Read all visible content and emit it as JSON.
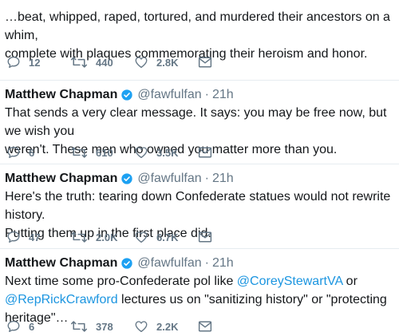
{
  "colors": {
    "text": "#14171a",
    "muted": "#657786",
    "link": "#1b95e0",
    "verified": "#1da1f2"
  },
  "tweets": [
    {
      "body": "…beat, whipped, raped, tortured, and murdered their ancestors on a whim,\ncomplete with plaques commemorating their heroism and honor.",
      "replies": "12",
      "retweets": "440",
      "likes": "2.8K"
    },
    {
      "name": "Matthew Chapman",
      "handle": "@fawfulfan",
      "time": "21h",
      "body": "That sends a very clear message. It says: you may be free now, but we wish you\nweren't. These men who owned you matter more than you.",
      "replies": "6",
      "retweets": "610",
      "likes": "3.5K"
    },
    {
      "name": "Matthew Chapman",
      "handle": "@fawfulfan",
      "time": "21h",
      "body": "Here's the truth: tearing down Confederate statues would not rewrite history.\nPutting them up in the first place did.",
      "replies": "47",
      "retweets": "2.0K",
      "likes": "6.7K"
    },
    {
      "name": "Matthew Chapman",
      "handle": "@fawfulfan",
      "time": "21h",
      "body_parts": [
        "Next time some pro-Confederate pol like ",
        "@CoreyStewartVA",
        " or\n",
        "@RepRickCrawford",
        " lectures us on \"sanitizing history\" or \"protecting heritage\"…"
      ],
      "replies": "6",
      "retweets": "378",
      "likes": "2.2K"
    }
  ],
  "icons": {
    "reply": "reply-icon",
    "retweet": "retweet-icon",
    "like": "heart-icon",
    "dm": "envelope-icon",
    "verified": "verified-badge-icon"
  }
}
